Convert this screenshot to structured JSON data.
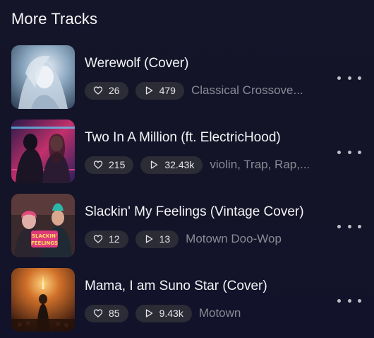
{
  "section": {
    "title": "More Tracks"
  },
  "tracks": [
    {
      "title": "Werewolf (Cover)",
      "likes": "26",
      "plays": "479",
      "genre": "Classical Crossove..."
    },
    {
      "title": "Two In A Million (ft. ElectricHood)",
      "likes": "215",
      "plays": "32.43k",
      "genre": "violin, Trap, Rap,..."
    },
    {
      "title": "Slackin' My Feelings (Vintage Cover)",
      "likes": "12",
      "plays": "13",
      "genre": "Motown Doo-Wop"
    },
    {
      "title": "Mama, I am Suno Star (Cover)",
      "likes": "85",
      "plays": "9.43k",
      "genre": "Motown"
    }
  ],
  "icons": {
    "like": "heart-icon",
    "plays": "play-icon",
    "more": "more-dots-icon"
  },
  "colors": {
    "background": "#141428",
    "pill": "#2c2c37",
    "genre_text": "#8a8a96"
  }
}
